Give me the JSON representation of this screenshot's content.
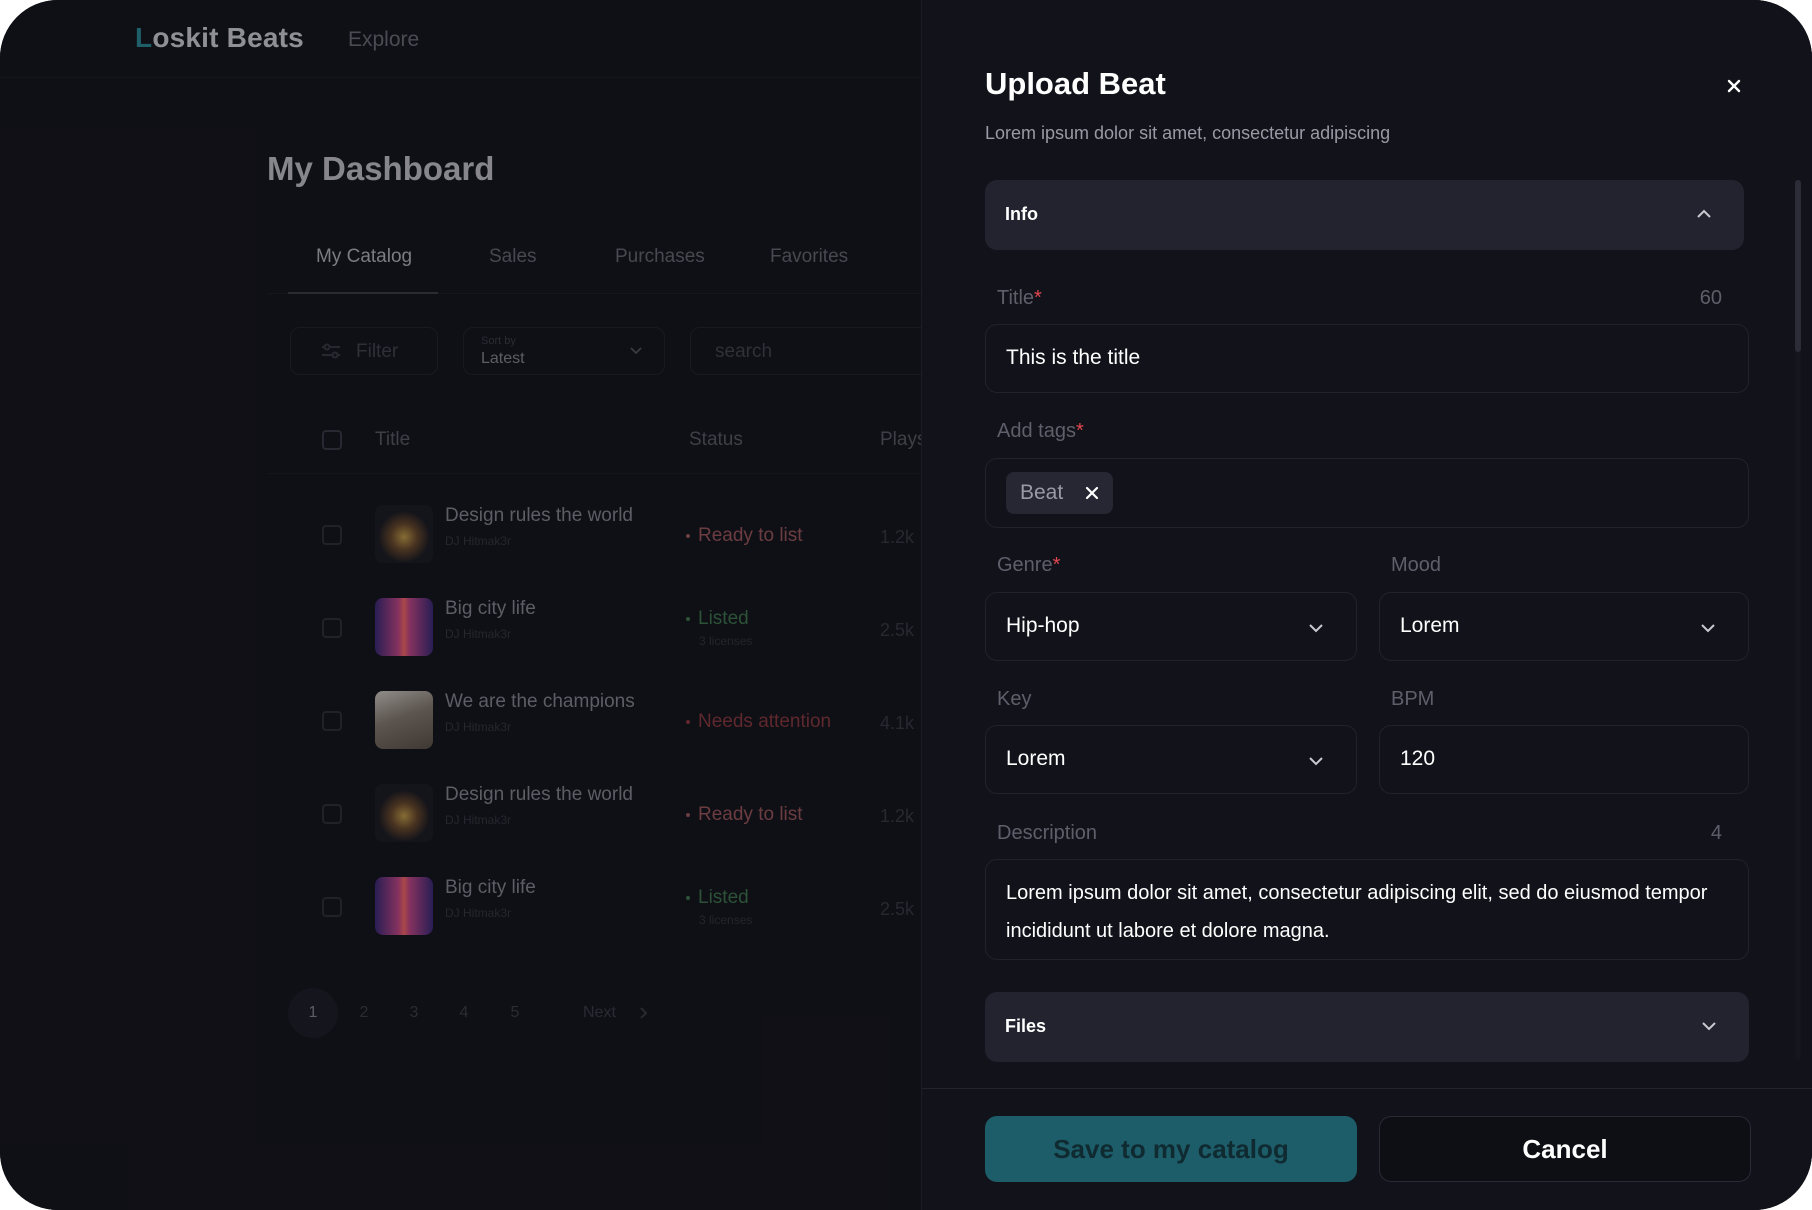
{
  "app": {
    "logo_first": "L",
    "logo_rest": "oskit Beats",
    "nav_explore": "Explore"
  },
  "dashboard": {
    "title": "My Dashboard",
    "tabs": [
      {
        "label": "My Catalog",
        "active": true
      },
      {
        "label": "Sales",
        "active": false
      },
      {
        "label": "Purchases",
        "active": false
      },
      {
        "label": "Favorites",
        "active": false
      }
    ],
    "filter_label": "Filter",
    "sort_caption": "Sort by",
    "sort_value": "Latest",
    "search_placeholder": "search",
    "table": {
      "columns": [
        "Title",
        "Status",
        "Plays"
      ],
      "rows": [
        {
          "title": "Design rules the world",
          "artist": "DJ Hitmak3r",
          "status": "Ready to list",
          "licenses": "",
          "plays": "1.2k"
        },
        {
          "title": "Big city life",
          "artist": "DJ Hitmak3r",
          "status": "Listed",
          "licenses": "3 licenses",
          "plays": "2.5k"
        },
        {
          "title": "We are the champions",
          "artist": "DJ Hitmak3r",
          "status": "Needs attention",
          "licenses": "",
          "plays": "4.1k"
        },
        {
          "title": "Design rules the world",
          "artist": "DJ Hitmak3r",
          "status": "Ready to list",
          "licenses": "",
          "plays": "1.2k"
        },
        {
          "title": "Big city life",
          "artist": "DJ Hitmak3r",
          "status": "Listed",
          "licenses": "3 licenses",
          "plays": "2.5k"
        }
      ]
    },
    "pagination": {
      "pages": [
        "1",
        "2",
        "3",
        "4",
        "5"
      ],
      "current": "1",
      "next_label": "Next"
    }
  },
  "modal": {
    "title": "Upload Beat",
    "subtitle": "Lorem ipsum dolor sit amet, consectetur adipiscing",
    "info_section": "Info",
    "files_section": "Files",
    "fields": {
      "title_label": "Title",
      "title_counter": "60",
      "title_value": "This is the title",
      "tags_label": "Add tags",
      "tag": "Beat",
      "genre_label": "Genre",
      "genre_value": "Hip-hop",
      "mood_label": "Mood",
      "mood_value": "Lorem",
      "key_label": "Key",
      "key_value": "Lorem",
      "bpm_label": "BPM",
      "bpm_value": "120",
      "description_label": "Description",
      "description_counter": "4",
      "description_value": "Lorem ipsum dolor sit amet, consectetur adipiscing elit, sed do eiusmod tempor incididunt ut labore et dolore magna."
    },
    "required_mark": "*",
    "save_label": "Save to my catalog",
    "cancel_label": "Cancel"
  },
  "colors": {
    "accent": "#1d5d69",
    "required": "#e0484e",
    "status_ready": "#a05a5d",
    "status_listed": "#3f7a4d",
    "status_attention": "#8c3a3d"
  }
}
